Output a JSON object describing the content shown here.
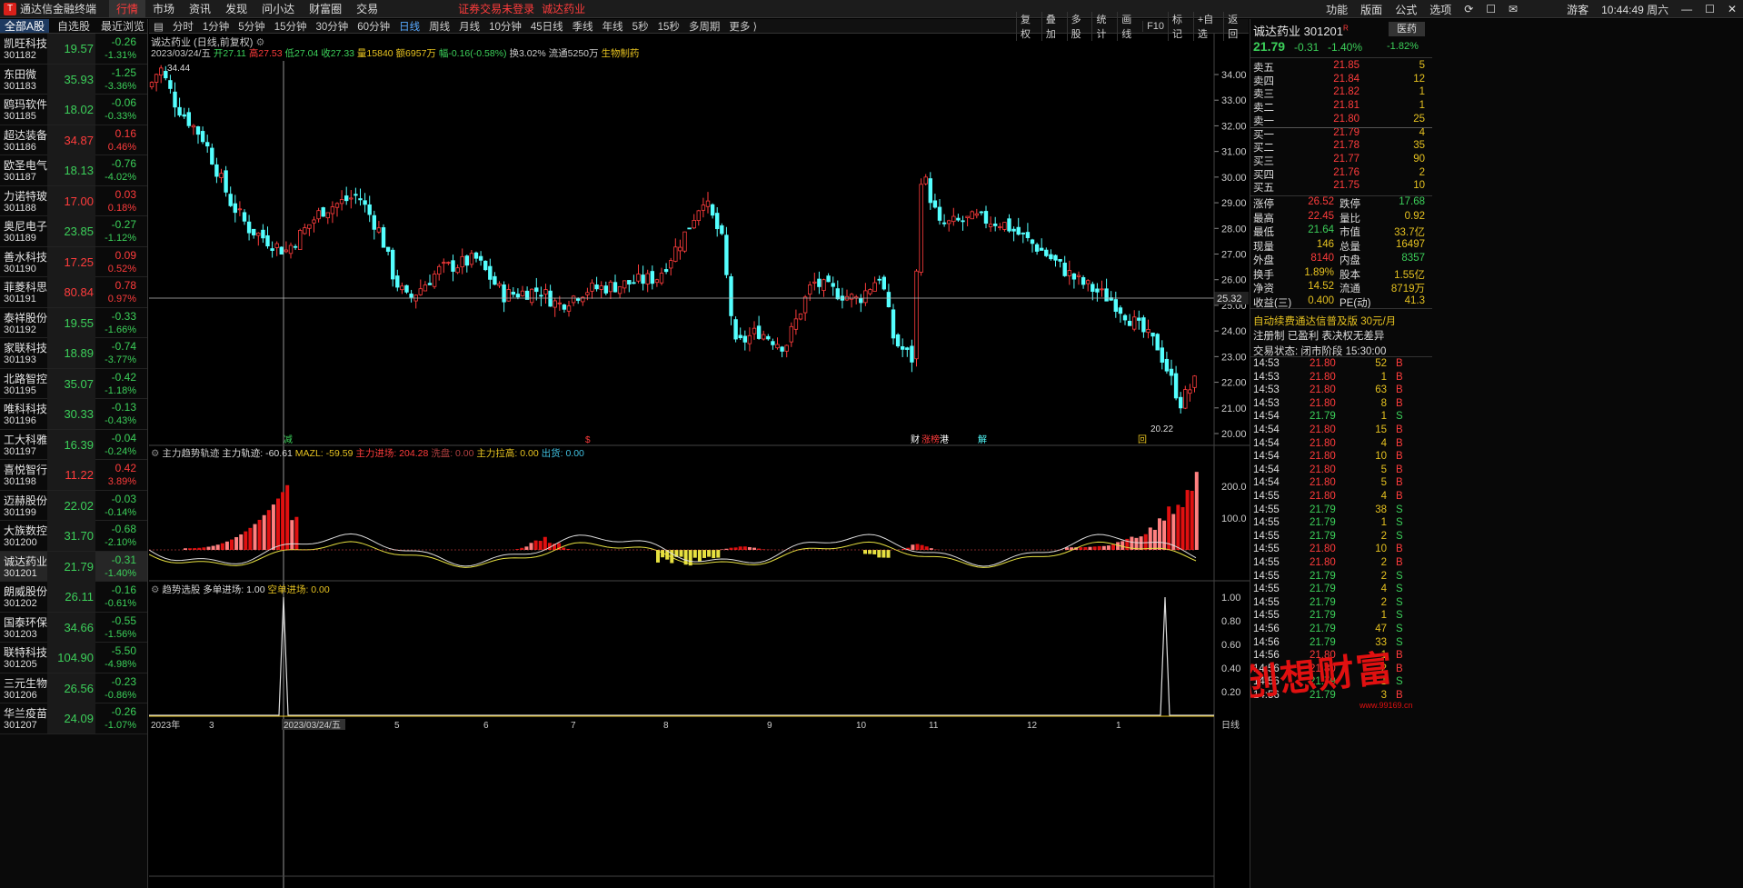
{
  "topbar": {
    "app": "通达信金融终端",
    "menus": [
      "行情",
      "市场",
      "资讯",
      "发现",
      "问小达",
      "财富圈",
      "交易"
    ],
    "notice": "证券交易未登录",
    "stock": "诚达药业",
    "right": [
      "功能",
      "版面",
      "公式",
      "选项",
      "游客",
      "10:44:49 周六"
    ]
  },
  "left": {
    "tabs": [
      "全部A股",
      "自选股",
      "最近浏览"
    ],
    "stocks": [
      {
        "name": "凯旺科技",
        "code": "301182",
        "price": "19.57",
        "chg": "-0.26",
        "pct": "-1.31%",
        "dir": "dn"
      },
      {
        "name": "东田微",
        "code": "301183",
        "price": "35.93",
        "chg": "-1.25",
        "pct": "-3.36%",
        "dir": "dn"
      },
      {
        "name": "鸥玛软件",
        "code": "301185",
        "price": "18.02",
        "chg": "-0.06",
        "pct": "-0.33%",
        "dir": "dn"
      },
      {
        "name": "超达装备",
        "code": "301186",
        "price": "34.87",
        "chg": "0.16",
        "pct": "0.46%",
        "dir": "up"
      },
      {
        "name": "欧圣电气",
        "code": "301187",
        "price": "18.13",
        "chg": "-0.76",
        "pct": "-4.02%",
        "dir": "dn"
      },
      {
        "name": "力诺特玻",
        "code": "301188",
        "price": "17.00",
        "chg": "0.03",
        "pct": "0.18%",
        "dir": "up"
      },
      {
        "name": "奥尼电子",
        "code": "301189",
        "price": "23.85",
        "chg": "-0.27",
        "pct": "-1.12%",
        "dir": "dn"
      },
      {
        "name": "善水科技",
        "code": "301190",
        "price": "17.25",
        "chg": "0.09",
        "pct": "0.52%",
        "dir": "up"
      },
      {
        "name": "菲菱科思",
        "code": "301191",
        "price": "80.84",
        "chg": "0.78",
        "pct": "0.97%",
        "dir": "up"
      },
      {
        "name": "泰祥股份",
        "code": "301192",
        "price": "19.55",
        "chg": "-0.33",
        "pct": "-1.66%",
        "dir": "dn"
      },
      {
        "name": "家联科技",
        "code": "301193",
        "price": "18.89",
        "chg": "-0.74",
        "pct": "-3.77%",
        "dir": "dn"
      },
      {
        "name": "北路智控",
        "code": "301195",
        "price": "35.07",
        "chg": "-0.42",
        "pct": "-1.18%",
        "dir": "dn"
      },
      {
        "name": "唯科科技",
        "code": "301196",
        "price": "30.33",
        "chg": "-0.13",
        "pct": "-0.43%",
        "dir": "dn"
      },
      {
        "name": "工大科雅",
        "code": "301197",
        "price": "16.39",
        "chg": "-0.04",
        "pct": "-0.24%",
        "dir": "dn"
      },
      {
        "name": "喜悦智行",
        "code": "301198",
        "price": "11.22",
        "chg": "0.42",
        "pct": "3.89%",
        "dir": "up"
      },
      {
        "name": "迈赫股份",
        "code": "301199",
        "price": "22.02",
        "chg": "-0.03",
        "pct": "-0.14%",
        "dir": "dn"
      },
      {
        "name": "大族数控",
        "code": "301200",
        "price": "31.70",
        "chg": "-0.68",
        "pct": "-2.10%",
        "dir": "dn"
      },
      {
        "name": "诚达药业",
        "code": "301201",
        "price": "21.79",
        "chg": "-0.31",
        "pct": "-1.40%",
        "dir": "dn",
        "sel": true
      },
      {
        "name": "朗威股份",
        "code": "301202",
        "price": "26.11",
        "chg": "-0.16",
        "pct": "-0.61%",
        "dir": "dn"
      },
      {
        "name": "国泰环保",
        "code": "301203",
        "price": "34.66",
        "chg": "-0.55",
        "pct": "-1.56%",
        "dir": "dn"
      },
      {
        "name": "联特科技",
        "code": "301205",
        "price": "104.90",
        "chg": "-5.50",
        "pct": "-4.98%",
        "dir": "dn"
      },
      {
        "name": "三元生物",
        "code": "301206",
        "price": "26.56",
        "chg": "-0.23",
        "pct": "-0.86%",
        "dir": "dn"
      },
      {
        "name": "华兰疫苗",
        "code": "301207",
        "price": "24.09",
        "chg": "-0.26",
        "pct": "-1.07%",
        "dir": "dn"
      }
    ]
  },
  "periods": [
    "分时",
    "1分钟",
    "5分钟",
    "15分钟",
    "30分钟",
    "60分钟",
    "日线",
    "周线",
    "月线",
    "10分钟",
    "45日线",
    "季线",
    "年线",
    "5秒",
    "15秒",
    "多周期",
    "更多 ⟩"
  ],
  "active_period": "日线",
  "tools": [
    "复权",
    "叠加",
    "多股",
    "统计",
    "画线",
    "F10",
    "标记",
    "+自选",
    "返回"
  ],
  "chart": {
    "title": "诚达药业 (日线,前复权)",
    "info": {
      "date": "2023/03/24/五",
      "open": "开27.11",
      "high": "高27.53",
      "low": "低27.04",
      "close": "收27.33",
      "vol": "量15840",
      "amt": "额6957万",
      "amp": "幅-0.16(-0.58%)",
      "turn": "换3.02%",
      "float": "流通5250万",
      "sector": "生物制药"
    },
    "max_label": "34.44",
    "min_label": "20.22",
    "cross_price": "25.32",
    "yticks": [
      "34.00",
      "33.00",
      "32.00",
      "31.00",
      "30.00",
      "29.00",
      "28.00",
      "27.00",
      "26.00",
      "25.00",
      "24.00",
      "23.00",
      "22.00",
      "21.00",
      "20.00"
    ],
    "xticks": [
      "2023年",
      "3",
      "2023/03/24/五",
      "5",
      "6",
      "7",
      "8",
      "9",
      "10",
      "11",
      "12",
      "1"
    ],
    "xunit": "日线",
    "markers": [
      "减",
      "$",
      "财",
      "涨",
      "榜",
      "港",
      "解",
      "回"
    ],
    "ind1": {
      "title": "主力趋势轨迹",
      "a": "主力轨迹: -60.61",
      "b": "MAZL: -59.59",
      "c": "主力进场: 204.28",
      "d": "洗盘: 0.00",
      "e": "主力拉高: 0.00",
      "f": "出货: 0.00",
      "yticks": [
        "200.0",
        "100.0"
      ]
    },
    "ind2": {
      "title": "趋势选股",
      "a": "多单进场: 1.00",
      "b": "空单进场: 0.00",
      "yticks": [
        "1.00",
        "0.80",
        "0.60",
        "0.40",
        "0.20"
      ]
    }
  },
  "right": {
    "name": "诚达药业",
    "code": "301201",
    "price": "21.79",
    "chg": "-0.31",
    "pct": "-1.40%",
    "sector": "医药",
    "sector_pct": "-1.82%",
    "asks": [
      {
        "l": "卖五",
        "p": "21.85",
        "v": "5"
      },
      {
        "l": "卖四",
        "p": "21.84",
        "v": "12"
      },
      {
        "l": "卖三",
        "p": "21.82",
        "v": "1"
      },
      {
        "l": "卖二",
        "p": "21.81",
        "v": "1"
      },
      {
        "l": "卖一",
        "p": "21.80",
        "v": "25"
      }
    ],
    "bids": [
      {
        "l": "买一",
        "p": "21.79",
        "v": "4"
      },
      {
        "l": "买二",
        "p": "21.78",
        "v": "35"
      },
      {
        "l": "买三",
        "p": "21.77",
        "v": "90"
      },
      {
        "l": "买四",
        "p": "21.76",
        "v": "2"
      },
      {
        "l": "买五",
        "p": "21.75",
        "v": "10"
      }
    ],
    "stats": [
      [
        "涨停",
        "26.52",
        "跌停",
        "17.68"
      ],
      [
        "最高",
        "22.45",
        "量比",
        "0.92"
      ],
      [
        "最低",
        "21.64",
        "市值",
        "33.7亿"
      ],
      [
        "现量",
        "146",
        "总量",
        "16497"
      ],
      [
        "外盘",
        "8140",
        "内盘",
        "8357"
      ],
      [
        "换手",
        "1.89%",
        "股本",
        "1.55亿"
      ],
      [
        "净资",
        "14.52",
        "流通",
        "8719万"
      ],
      [
        "收益(三)",
        "0.400",
        "PE(动)",
        "41.3"
      ]
    ],
    "ad": "自动续费通达信普及版 30元/月",
    "reg": "注册制 已盈利 表决权无差异",
    "status": "交易状态: 闭市阶段 15:30:00",
    "ticks": [
      [
        "14:53",
        "21.80",
        "52",
        "B"
      ],
      [
        "14:53",
        "21.80",
        "1",
        "B"
      ],
      [
        "14:53",
        "21.80",
        "63",
        "B"
      ],
      [
        "14:53",
        "21.80",
        "8",
        "B"
      ],
      [
        "14:54",
        "21.79",
        "1",
        "S"
      ],
      [
        "14:54",
        "21.80",
        "15",
        "B"
      ],
      [
        "14:54",
        "21.80",
        "4",
        "B"
      ],
      [
        "14:54",
        "21.80",
        "10",
        "B"
      ],
      [
        "14:54",
        "21.80",
        "5",
        "B"
      ],
      [
        "14:54",
        "21.80",
        "5",
        "B"
      ],
      [
        "14:55",
        "21.80",
        "4",
        "B"
      ],
      [
        "14:55",
        "21.79",
        "38",
        "S"
      ],
      [
        "14:55",
        "21.79",
        "1",
        "S"
      ],
      [
        "14:55",
        "21.79",
        "2",
        "S"
      ],
      [
        "14:55",
        "21.80",
        "10",
        "B"
      ],
      [
        "14:55",
        "21.80",
        "2",
        "B"
      ],
      [
        "14:55",
        "21.79",
        "2",
        "S"
      ],
      [
        "14:55",
        "21.79",
        "4",
        "S"
      ],
      [
        "14:55",
        "21.79",
        "2",
        "S"
      ],
      [
        "14:55",
        "21.79",
        "1",
        "S"
      ],
      [
        "14:56",
        "21.79",
        "47",
        "S"
      ],
      [
        "14:56",
        "21.79",
        "33",
        "S"
      ],
      [
        "14:56",
        "21.80",
        "1",
        "B"
      ],
      [
        "14:56",
        "21.80",
        "2",
        "B"
      ],
      [
        "14:56",
        "21.79",
        "1",
        "S"
      ],
      [
        "14:56",
        "21.79",
        "3",
        "B"
      ]
    ],
    "watermark": "创想财富",
    "watermark_url": "www.99169.cn"
  },
  "chart_data": {
    "type": "candlestick",
    "title": "诚达药业 (日线,前复权)",
    "ylim": [
      20,
      34.5
    ]
  }
}
